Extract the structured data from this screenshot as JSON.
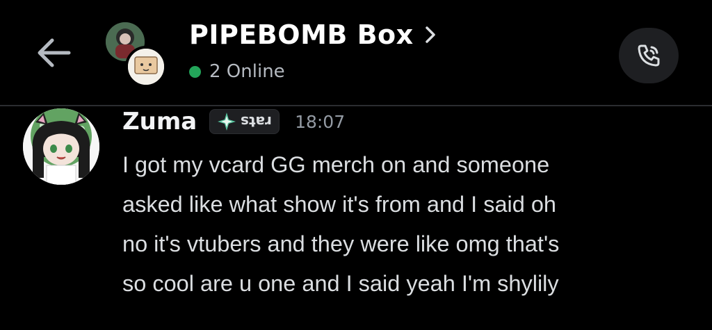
{
  "header": {
    "group_name": "PIPEBOMB Box",
    "online_status": "2 Online",
    "back_icon": "arrow-left-icon",
    "call_icon": "phone-call-icon",
    "chevron_icon": "chevron-right-icon",
    "online_color": "#23a55a"
  },
  "message": {
    "author": "Zuma",
    "tag": "rats",
    "timestamp": "18:07",
    "lines": [
      "I got my vcard GG merch on and someone",
      "asked like what show it's from and I said oh",
      "no it's vtubers and they were like omg that's",
      "so cool are u one and I said yeah I'm shylily"
    ]
  },
  "colors": {
    "background": "#000000",
    "text_primary": "#f2f3f5",
    "text_muted": "#949ba4",
    "button_bg": "#1e1f22"
  }
}
